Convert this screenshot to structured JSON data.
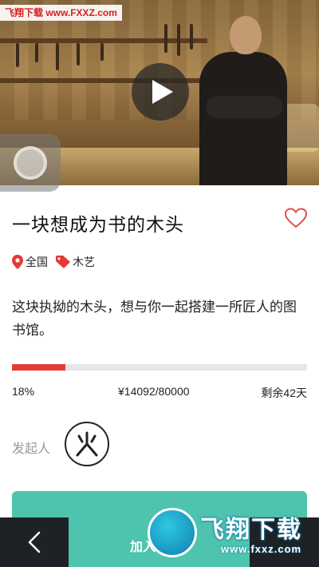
{
  "watermark": {
    "top_text": "飞翔下载 www.FXXZ.com",
    "logo_name": "飞翔下载",
    "logo_url": "www.fxxz.com"
  },
  "hero": {
    "media": "workshop video thumbnail",
    "play_icon": "play-icon"
  },
  "project": {
    "title": "一块想成为书的木头",
    "favorite_icon": "heart-outline-icon",
    "location_icon": "location-pin-icon",
    "location": "全国",
    "category_icon": "tag-icon",
    "category": "木艺",
    "description": "这块执拗的木头，想与你一起搭建一所匠人的图书馆。"
  },
  "funding": {
    "progress": 0.18,
    "percent_text": "18%",
    "amount_text": "¥14092/80000",
    "remaining_text": "剩余42天"
  },
  "initiator": {
    "label": "发起人",
    "avatar_icon": "fire-character-avatar"
  },
  "actions": {
    "join_label": "加入",
    "back_icon": "back-arrow-icon"
  },
  "colors": {
    "accent_red": "#e53935",
    "join_green": "#4ec3ad",
    "bar_dark": "#1e2226",
    "heart": "#d9534f"
  }
}
